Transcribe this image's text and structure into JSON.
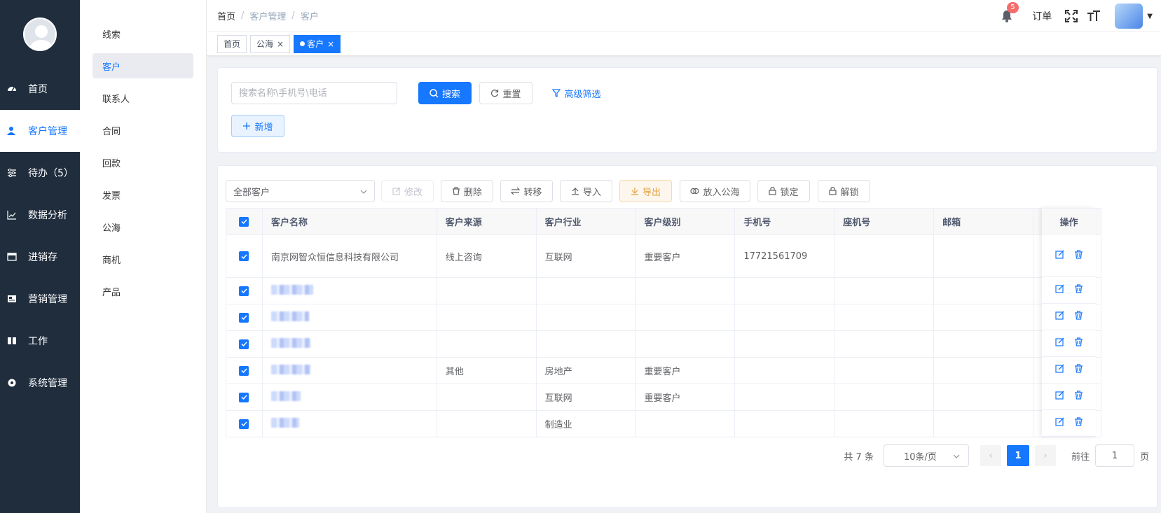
{
  "sidebar": {
    "items": [
      {
        "label": "首页",
        "icon": "dashboard-icon"
      },
      {
        "label": "客户管理",
        "icon": "user-icon",
        "active": true
      },
      {
        "label": "待办（5）",
        "icon": "sliders-icon"
      },
      {
        "label": "数据分析",
        "icon": "chart-line-icon"
      },
      {
        "label": "进销存",
        "icon": "window-icon"
      },
      {
        "label": "营销管理",
        "icon": "image-card-icon"
      },
      {
        "label": "工作",
        "icon": "book-icon"
      },
      {
        "label": "系统管理",
        "icon": "gear-icon"
      }
    ]
  },
  "submenu": {
    "items": [
      "线索",
      "客户",
      "联系人",
      "合同",
      "回款",
      "发票",
      "公海",
      "商机",
      "产品"
    ],
    "active_index": 1
  },
  "header": {
    "breadcrumb": [
      "首页",
      "客户管理",
      "客户"
    ],
    "notifications": "5",
    "orders_label": "订单"
  },
  "tags": {
    "items": [
      "首页",
      "公海",
      "客户"
    ]
  },
  "search": {
    "placeholder": "搜索名称\\手机号\\电话",
    "search_label": "搜索",
    "reset_label": "重置",
    "advanced_label": "高级筛选",
    "add_label": "新增"
  },
  "toolbar": {
    "filter_value": "全部客户",
    "edit_label": "修改",
    "delete_label": "删除",
    "transfer_label": "转移",
    "import_label": "导入",
    "export_label": "导出",
    "to_pool_label": "放入公海",
    "lock_label": "锁定",
    "unlock_label": "解锁"
  },
  "table": {
    "columns": [
      "客户名称",
      "客户来源",
      "客户行业",
      "客户级别",
      "手机号",
      "座机号",
      "邮箱"
    ],
    "ops_header": "操作",
    "rows": [
      {
        "name": "南京网智众恒信息科技有限公司",
        "source": "线上咨询",
        "industry": "互联网",
        "level": "重要客户",
        "mobile": "17721561709",
        "phone": "",
        "email": ""
      },
      {
        "name": "",
        "source": "",
        "industry": "",
        "level": "",
        "mobile": "",
        "phone": "",
        "email": ""
      },
      {
        "name": "",
        "source": "",
        "industry": "",
        "level": "",
        "mobile": "",
        "phone": "",
        "email": ""
      },
      {
        "name": "",
        "source": "",
        "industry": "",
        "level": "",
        "mobile": "",
        "phone": "",
        "email": ""
      },
      {
        "name": "",
        "source": "其他",
        "industry": "房地产",
        "level": "重要客户",
        "mobile": "",
        "phone": "",
        "email": ""
      },
      {
        "name": "",
        "source": "",
        "industry": "互联网",
        "level": "重要客户",
        "mobile": "",
        "phone": "",
        "email": ""
      },
      {
        "name": "",
        "source": "",
        "industry": "制造业",
        "level": "",
        "mobile": "",
        "phone": "",
        "email": ""
      }
    ]
  },
  "pagination": {
    "total_label": "共 7 条",
    "page_size": "10条/页",
    "current_page": "1",
    "goto_label": "前往",
    "goto_value": "1",
    "page_suffix": "页"
  },
  "colors": {
    "primary": "#1677ff",
    "sidebar_bg": "#1f2d3d",
    "warning": "#e6a23c",
    "danger": "#f56c6c"
  }
}
